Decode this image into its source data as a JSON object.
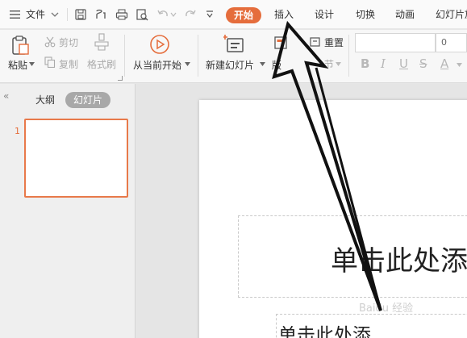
{
  "menubar": {
    "menu_icon": "hamburger-icon",
    "file_label": "文件",
    "tabs": [
      {
        "label": "开始"
      },
      {
        "label": "插入"
      },
      {
        "label": "设计"
      },
      {
        "label": "切换"
      },
      {
        "label": "动画"
      },
      {
        "label": "幻灯片放"
      }
    ]
  },
  "ribbon": {
    "paste": "粘贴",
    "cut": "剪切",
    "copy": "复制",
    "format_painter": "格式刷",
    "play_from_current": "从当前开始",
    "new_slide": "新建幻灯片",
    "layout": "版",
    "reset": "重置",
    "section": "节",
    "font_size": "0",
    "format_buttons": [
      "B",
      "I",
      "U",
      "S",
      "A"
    ]
  },
  "left_panel": {
    "tab_outline": "大纲",
    "tab_slides": "幻灯片",
    "slide_number": "1"
  },
  "slide": {
    "title_placeholder": "单击此处添",
    "subtitle_placeholder": "单击此处添",
    "watermark": "Baidu 经验"
  },
  "colors": {
    "accent": "#e56d3c",
    "thumb_border": "#e8794a"
  }
}
